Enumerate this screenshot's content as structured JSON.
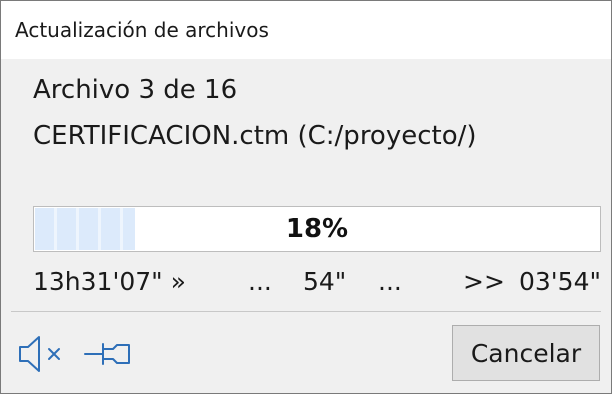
{
  "window": {
    "title": "Actualización de archivos"
  },
  "status": {
    "file_count": "Archivo 3 de 16",
    "file_name": "CERTIFICACION.ctm (C:/proyecto/)"
  },
  "progress": {
    "percent": 18,
    "label": "18%"
  },
  "timing": {
    "elapsed": "13h31'07\" »",
    "sep1": "...",
    "current": "54\"",
    "sep2": "...",
    "remaining_marker": ">>",
    "remaining": "03'54\""
  },
  "footer": {
    "mute_icon": "speaker-muted-icon",
    "pin_icon": "pin-icon",
    "cancel_label": "Cancelar"
  },
  "colors": {
    "window_background": "#f0f0f0",
    "title_background": "#ffffff",
    "progress_fill": "#dceafb",
    "icon_stroke": "#2e6fb8",
    "button_background": "#e1e1e1"
  }
}
